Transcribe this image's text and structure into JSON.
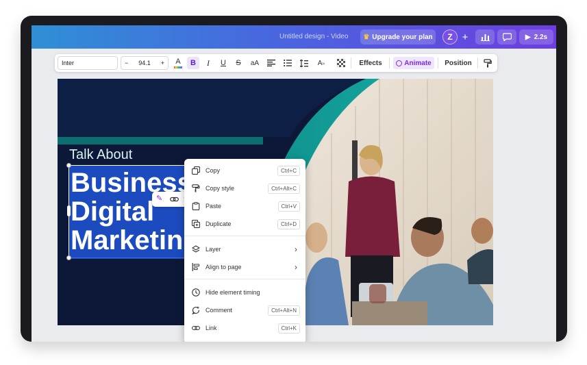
{
  "header": {
    "doc_title": "Untitled design - Video",
    "upgrade_label": "Upgrade your plan",
    "avatar_letter": "Z",
    "plus_label": "+",
    "play_duration": "2.2s"
  },
  "toolbar": {
    "font_name": "Inter",
    "font_size": "94.1",
    "minus_label": "−",
    "plus_label": "+",
    "color_letter": "A",
    "bold_label": "B",
    "italic_label": "I",
    "underline_label": "U",
    "strike_label": "S",
    "case_label": "aA",
    "effects_label": "Effects",
    "animate_label": "Animate",
    "position_label": "Position"
  },
  "canvas": {
    "subtitle": "Talk About",
    "title_lines": [
      "Business",
      "Digital",
      "Marketing"
    ]
  },
  "context_menu": {
    "items": [
      {
        "label": "Copy",
        "shortcut": "Ctrl+C",
        "icon": "copy-icon"
      },
      {
        "label": "Copy style",
        "shortcut": "Ctrl+Alt+C",
        "icon": "paint-roller-icon"
      },
      {
        "label": "Paste",
        "shortcut": "Ctrl+V",
        "icon": "clipboard-icon"
      },
      {
        "label": "Duplicate",
        "shortcut": "Ctrl+D",
        "icon": "duplicate-icon"
      },
      {
        "label": "Layer",
        "shortcut": "",
        "icon": "layers-icon"
      },
      {
        "label": "Align to page",
        "shortcut": "",
        "icon": "align-icon"
      },
      {
        "label": "Hide element timing",
        "shortcut": "",
        "icon": "clock-icon"
      },
      {
        "label": "Comment",
        "shortcut": "Ctrl+Alt+N",
        "icon": "comment-icon"
      },
      {
        "label": "Link",
        "shortcut": "Ctrl+K",
        "icon": "link-icon"
      }
    ]
  },
  "colors": {
    "accent_purple": "#7d2ae8",
    "topbar_start": "#2f8fd6",
    "topbar_end": "#6d3ee0",
    "canvas_navy": "#0d1738",
    "teal": "#10a5a0",
    "selection_blue": "#1f55d6"
  }
}
